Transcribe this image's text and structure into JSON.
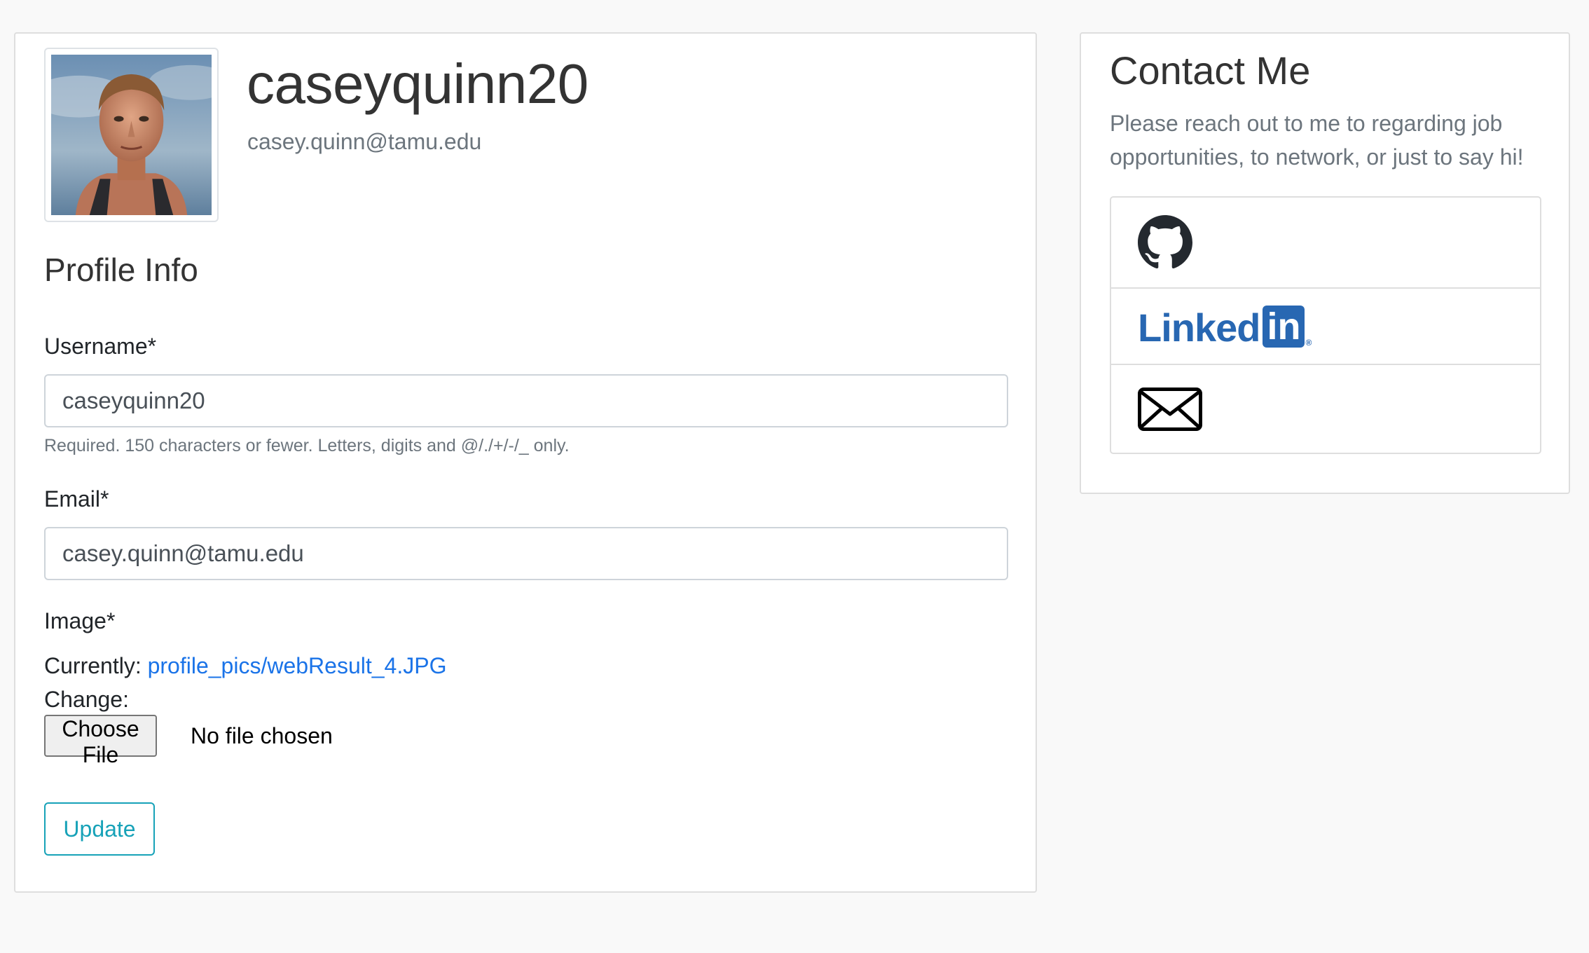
{
  "profile": {
    "username_heading": "caseyquinn20",
    "email_sub": "casey.quinn@tamu.edu",
    "section_title": "Profile Info"
  },
  "form": {
    "username_label": "Username*",
    "username_value": "caseyquinn20",
    "username_help": "Required. 150 characters or fewer. Letters, digits and @/./+/-/_ only.",
    "email_label": "Email*",
    "email_value": "casey.quinn@tamu.edu",
    "image_label": "Image*",
    "currently_label": "Currently:",
    "current_file": "profile_pics/webResult_4.JPG",
    "change_label": "Change:",
    "choose_file_label": "Choose File",
    "no_file_text": "No file chosen",
    "update_label": "Update"
  },
  "contact": {
    "title": "Contact Me",
    "description": "Please reach out to me to regarding job opportunities, to network, or just to say hi!",
    "links": [
      {
        "icon": "github-icon"
      },
      {
        "icon": "linkedin-logo"
      },
      {
        "icon": "envelope-icon"
      }
    ],
    "linkedin_logo_text": "Linked",
    "linkedin_logo_box_text": "in"
  },
  "colors": {
    "link": "#1a73e8",
    "accent_info": "#17a2b8",
    "linkedin_blue": "#2867b2",
    "muted": "#6c757d"
  }
}
